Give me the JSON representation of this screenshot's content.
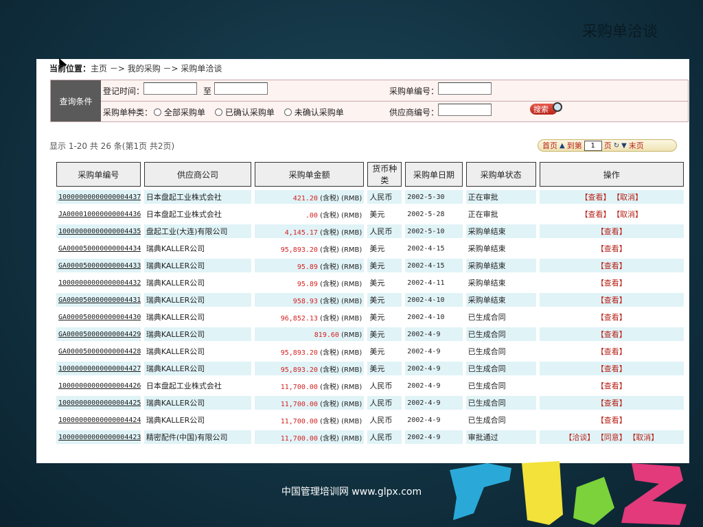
{
  "slide": {
    "title": "采购单洽谈",
    "footer": "中国管理培训网    www.glpx.com"
  },
  "breadcrumb": {
    "label": "当前位置：",
    "path": "主页 －> 我的采购 －> 采购单洽谈"
  },
  "query": {
    "label": "查询条件",
    "reg_time_label": "登记时间：",
    "to_label": "至",
    "order_no_label": "采购单编号：",
    "type_label": "采购单种类：",
    "radio_all": "全部采购单",
    "radio_confirmed": "已确认采购单",
    "radio_unconfirmed": "未确认采购单",
    "supplier_no_label": "供应商编号：",
    "search_label": "搜索"
  },
  "summary": "显示 1-20 共 26 条(第1页 共2页)",
  "pager": {
    "first": "首页",
    "goto": "到第",
    "page_value": "1",
    "page_unit": "页",
    "last": "末页"
  },
  "table": {
    "headers": [
      "采购单编号",
      "供应商公司",
      "采购单金额",
      "货币种类",
      "采购单日期",
      "采购单状态",
      "操作"
    ],
    "rows": [
      {
        "code": "10000000000000004437",
        "supplier": "日本盘起工业株式会社",
        "amount": "421.20",
        "suffix": " (含税) (RMB)",
        "currency": "人民币",
        "date": "2002-5-30",
        "status": "正在审批",
        "ops": [
          "【查看】",
          "【取消】"
        ]
      },
      {
        "code": "JA000010000000004436",
        "supplier": "日本盘起工业株式会社",
        "amount": ".00",
        "suffix": " (含税) (RMB)",
        "currency": "美元",
        "date": "2002-5-28",
        "status": "正在审批",
        "ops": [
          "【查看】",
          "【取消】"
        ]
      },
      {
        "code": "10000000000000004435",
        "supplier": "盘起工业(大连)有限公司",
        "amount": "4,145.17",
        "suffix": " (含税) (RMB)",
        "currency": "人民币",
        "date": "2002-5-10",
        "status": "采购单结束",
        "ops": [
          "【查看】"
        ]
      },
      {
        "code": "GA000050000000004434",
        "supplier": "瑞典KALLER公司",
        "amount": "95,893.20",
        "suffix": " (含税) (RMB)",
        "currency": "美元",
        "date": "2002-4-15",
        "status": "采购单结束",
        "ops": [
          "【查看】"
        ]
      },
      {
        "code": "GA000050000000004433",
        "supplier": "瑞典KALLER公司",
        "amount": "95.89",
        "suffix": " (含税) (RMB)",
        "currency": "美元",
        "date": "2002-4-15",
        "status": "采购单结束",
        "ops": [
          "【查看】"
        ]
      },
      {
        "code": "10000000000000004432",
        "supplier": "瑞典KALLER公司",
        "amount": "95.89",
        "suffix": " (含税) (RMB)",
        "currency": "美元",
        "date": "2002-4-11",
        "status": "采购单结束",
        "ops": [
          "【查看】"
        ]
      },
      {
        "code": "GA000050000000004431",
        "supplier": "瑞典KALLER公司",
        "amount": "958.93",
        "suffix": " (含税) (RMB)",
        "currency": "美元",
        "date": "2002-4-10",
        "status": "采购单结束",
        "ops": [
          "【查看】"
        ]
      },
      {
        "code": "GA000050000000004430",
        "supplier": "瑞典KALLER公司",
        "amount": "96,852.13",
        "suffix": " (含税) (RMB)",
        "currency": "美元",
        "date": "2002-4-10",
        "status": "已生成合同",
        "ops": [
          "【查看】"
        ]
      },
      {
        "code": "GA000050000000004429",
        "supplier": "瑞典KALLER公司",
        "amount": "819.60",
        "suffix": " (RMB)",
        "currency": "美元",
        "date": "2002-4-9",
        "status": "已生成合同",
        "ops": [
          "【查看】"
        ]
      },
      {
        "code": "GA000050000000004428",
        "supplier": "瑞典KALLER公司",
        "amount": "95,893.20",
        "suffix": " (含税) (RMB)",
        "currency": "美元",
        "date": "2002-4-9",
        "status": "已生成合同",
        "ops": [
          "【查看】"
        ]
      },
      {
        "code": "10000000000000004427",
        "supplier": "瑞典KALLER公司",
        "amount": "95,893.20",
        "suffix": " (含税) (RMB)",
        "currency": "美元",
        "date": "2002-4-9",
        "status": "已生成合同",
        "ops": [
          "【查看】"
        ]
      },
      {
        "code": "10000000000000004426",
        "supplier": "日本盘起工业株式会社",
        "amount": "11,700.00",
        "suffix": " (含税) (RMB)",
        "currency": "人民币",
        "date": "2002-4-9",
        "status": "已生成合同",
        "ops": [
          "【查看】"
        ]
      },
      {
        "code": "10000000000000004425",
        "supplier": "瑞典KALLER公司",
        "amount": "11,700.00",
        "suffix": " (含税) (RMB)",
        "currency": "人民币",
        "date": "2002-4-9",
        "status": "已生成合同",
        "ops": [
          "【查看】"
        ]
      },
      {
        "code": "10000000000000004424",
        "supplier": "瑞典KALLER公司",
        "amount": "11,700.00",
        "suffix": " (含税) (RMB)",
        "currency": "人民币",
        "date": "2002-4-9",
        "status": "已生成合同",
        "ops": [
          "【查看】"
        ]
      },
      {
        "code": "10000000000000004423",
        "supplier": "精密配件(中国)有限公司",
        "amount": "11,700.00",
        "suffix": " (含税) (RMB)",
        "currency": "人民币",
        "date": "2002-4-9",
        "status": "审批通过",
        "ops": [
          "【洽谈】",
          "【同意】",
          "【取消】"
        ]
      }
    ]
  },
  "colors": {
    "accent_red": "#d42020",
    "row_alt": "#e0f3f7",
    "label_bg": "#5a5a5a"
  }
}
